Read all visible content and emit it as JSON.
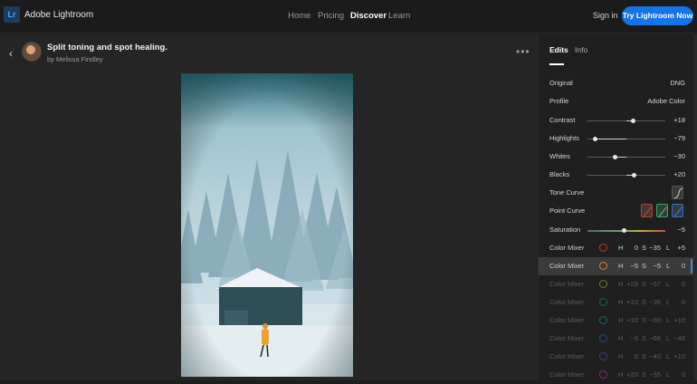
{
  "header": {
    "app_name": "Adobe Lightroom",
    "logo_text": "Lr",
    "nav": [
      {
        "label": "Home",
        "active": false
      },
      {
        "label": "Pricing",
        "active": false
      },
      {
        "label": "Discover",
        "active": true
      },
      {
        "label": "Learn",
        "active": false
      }
    ],
    "sign_in": "Sign in",
    "cta": "Try Lightroom Now"
  },
  "tutorial": {
    "title": "Split toning and spot healing.",
    "author": "by Melissa Findley"
  },
  "panel": {
    "tabs": [
      {
        "label": "Edits",
        "active": true
      },
      {
        "label": "Info",
        "active": false
      }
    ],
    "original": {
      "label": "Original",
      "value": "DNG"
    },
    "profile": {
      "label": "Profile",
      "value": "Adobe Color"
    },
    "sliders": [
      {
        "label": "Contrast",
        "value": "+18",
        "level": 0.59
      },
      {
        "label": "Highlights",
        "value": "−79",
        "level": 0.1
      },
      {
        "label": "Whites",
        "value": "−30",
        "level": 0.35
      },
      {
        "label": "Blacks",
        "value": "+20",
        "level": 0.6
      }
    ],
    "tone_curve": {
      "label": "Tone Curve"
    },
    "point_curve": {
      "label": "Point Curve",
      "channels": [
        "#c0392b",
        "#27ae60",
        "#2e6fc9"
      ]
    },
    "saturation": {
      "label": "Saturation",
      "value": "−5",
      "level": 0.47
    },
    "color_mixer": [
      {
        "label": "Color Mixer",
        "color": "#c0392b",
        "h": "0",
        "s": "−35",
        "l": "+5",
        "dim": false,
        "selected": false
      },
      {
        "label": "Color Mixer",
        "color": "#e67e22",
        "h": "−5",
        "s": "−5",
        "l": "0",
        "dim": false,
        "selected": true
      },
      {
        "label": "Color Mixer",
        "color": "#c9b52b",
        "h": "+28",
        "s": "−57",
        "l": "0",
        "dim": true,
        "selected": false
      },
      {
        "label": "Color Mixer",
        "color": "#2e9e4f",
        "h": "+10",
        "s": "−35",
        "l": "0",
        "dim": true,
        "selected": false
      },
      {
        "label": "Color Mixer",
        "color": "#1fa3a3",
        "h": "+10",
        "s": "−50",
        "l": "+10",
        "dim": true,
        "selected": false
      },
      {
        "label": "Color Mixer",
        "color": "#3a6fd8",
        "h": "−5",
        "s": "−68",
        "l": "−48",
        "dim": true,
        "selected": false
      },
      {
        "label": "Color Mixer",
        "color": "#6a4ad8",
        "h": "0",
        "s": "−40",
        "l": "+10",
        "dim": true,
        "selected": false
      },
      {
        "label": "Color Mixer",
        "color": "#c03fa8",
        "h": "+20",
        "s": "−35",
        "l": "0",
        "dim": true,
        "selected": false
      }
    ],
    "letters": {
      "h": "H",
      "s": "S",
      "l": "L"
    }
  }
}
